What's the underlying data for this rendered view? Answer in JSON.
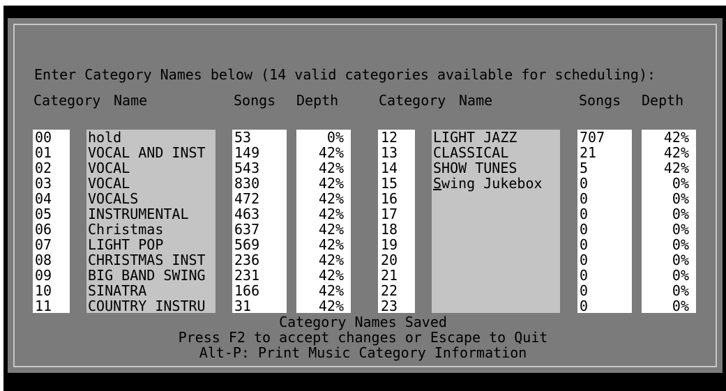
{
  "prompt": "Enter Category Names below (14 valid categories available for scheduling):",
  "headers": {
    "category": "Category",
    "name": "Name",
    "songs": "Songs",
    "depth": "Depth"
  },
  "left_block": {
    "category_codes": [
      "00",
      "01",
      "02",
      "03",
      "04",
      "05",
      "06",
      "07",
      "08",
      "09",
      "10",
      "11"
    ],
    "names": [
      "hold",
      "VOCAL AND INST",
      "VOCAL",
      "VOCAL",
      "VOCALS",
      "INSTRUMENTAL",
      "Christmas",
      "LIGHT POP",
      "CHRISTMAS INST",
      "BIG BAND SWING",
      "SINATRA",
      "COUNTRY INSTRU"
    ],
    "songs": [
      "53",
      "149",
      "543",
      "830",
      "472",
      "463",
      "637",
      "569",
      "236",
      "231",
      "166",
      "31"
    ],
    "depth": [
      "0%",
      "42%",
      "42%",
      "42%",
      "42%",
      "42%",
      "42%",
      "42%",
      "42%",
      "42%",
      "42%",
      "42%"
    ]
  },
  "right_block": {
    "category_codes": [
      "12",
      "13",
      "14",
      "15",
      "16",
      "17",
      "18",
      "19",
      "20",
      "21",
      "22",
      "23"
    ],
    "names": [
      "LIGHT JAZZ",
      "CLASSICAL",
      "SHOW TUNES",
      "Swing Jukebox",
      "",
      "",
      "",
      "",
      "",
      "",
      "",
      ""
    ],
    "songs": [
      "707",
      "21",
      "5",
      "0",
      "0",
      "0",
      "0",
      "0",
      "0",
      "0",
      "0",
      "0"
    ],
    "depth": [
      "42%",
      "42%",
      "42%",
      "0%",
      "0%",
      "0%",
      "0%",
      "0%",
      "0%",
      "0%",
      "0%",
      "0%"
    ]
  },
  "status": {
    "saved": "Category Names Saved",
    "help": "Press F2 to accept changes or Escape to Quit",
    "print": "Alt-P: Print Music Category Information"
  }
}
